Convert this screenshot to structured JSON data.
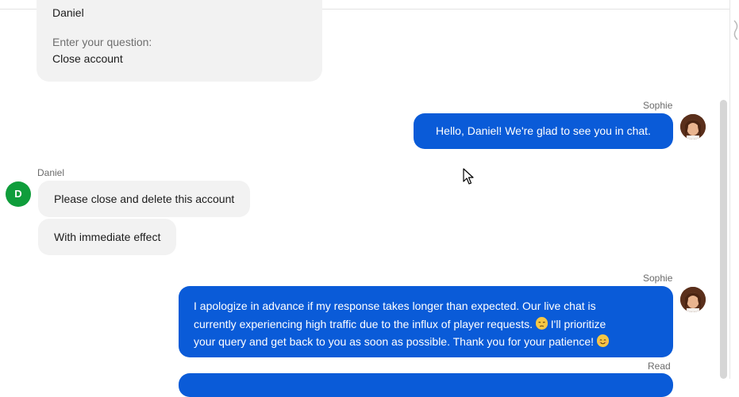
{
  "form_card": {
    "name_value": "Daniel",
    "question_label": "Enter your question:",
    "question_value": "Close account"
  },
  "messages": {
    "agent_name_1": "Sophie",
    "greeting": "Hello, Daniel! We're glad to see you in chat.",
    "user_name": "Daniel",
    "user_avatar_initial": "D",
    "user_msg_1": "Please close and delete this account",
    "user_msg_2": "With immediate effect",
    "agent_name_2": "Sophie",
    "apology_line_1": "I apologize in advance if my response takes longer than expected. Our live chat is",
    "apology_line_2a": "currently experiencing high traffic due to the influx of player requests.",
    "apology_line_2b": "I'll prioritize",
    "apology_line_3": "your query and get back to you as soon as possible. Thank you for your patience!",
    "read_status": "Read"
  },
  "icons": {
    "agent_avatar": "agent-photo-avatar",
    "sad_emoji": "disappointed-face-emoji",
    "smile_emoji": "smiling-face-emoji",
    "cursor": "mouse-pointer-icon"
  },
  "colors": {
    "agent_bubble": "#0a5bd8",
    "user_bubble": "#f2f2f2",
    "user_avatar": "#0f9d3b"
  }
}
